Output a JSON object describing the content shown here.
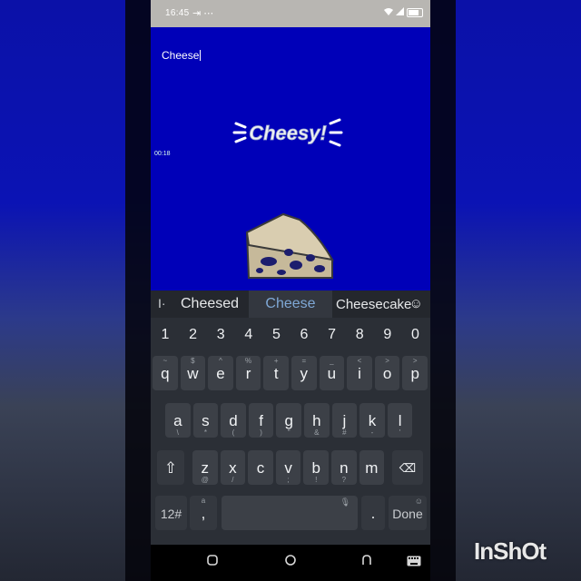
{
  "status_bar": {
    "time": "16:45",
    "misc": "⇥  ⋯",
    "icons": [
      "wifi-icon",
      "signal-icon",
      "battery-icon"
    ]
  },
  "canvas": {
    "text_field_value": "Cheese",
    "timer": "00:18",
    "sticker_text": "Cheesy!",
    "background_color": "#0000b8"
  },
  "keyboard": {
    "suggestions": [
      "Cheesed",
      "Cheese",
      "Cheesecake"
    ],
    "number_row": [
      "1",
      "2",
      "3",
      "4",
      "5",
      "6",
      "7",
      "8",
      "9",
      "0"
    ],
    "row1": [
      {
        "k": "q",
        "alt": "~"
      },
      {
        "k": "w",
        "alt": "$"
      },
      {
        "k": "e",
        "alt": "^"
      },
      {
        "k": "r",
        "alt": "%"
      },
      {
        "k": "t",
        "alt": "+"
      },
      {
        "k": "y",
        "alt": "="
      },
      {
        "k": "u",
        "alt": "_"
      },
      {
        "k": "i",
        "alt": "<"
      },
      {
        "k": "o",
        "alt": ">"
      },
      {
        "k": "p",
        "alt": ">"
      }
    ],
    "row2": [
      {
        "k": "a",
        "alt": "\\"
      },
      {
        "k": "s",
        "alt": "*"
      },
      {
        "k": "d",
        "alt": "("
      },
      {
        "k": "f",
        "alt": ")"
      },
      {
        "k": "g",
        "alt": "\""
      },
      {
        "k": "h",
        "alt": "&"
      },
      {
        "k": "j",
        "alt": "#"
      },
      {
        "k": "k",
        "alt": "-"
      },
      {
        "k": "l",
        "alt": "'"
      }
    ],
    "row3": [
      {
        "k": "z",
        "alt": "@"
      },
      {
        "k": "x",
        "alt": "/"
      },
      {
        "k": "c",
        "alt": ""
      },
      {
        "k": "v",
        "alt": ";"
      },
      {
        "k": "b",
        "alt": "!"
      },
      {
        "k": "n",
        "alt": "?"
      },
      {
        "k": "m",
        "alt": ""
      }
    ],
    "sym_label": "12#",
    "comma_label": ",",
    "comma_alt": "a",
    "period_label": ".",
    "done_label": "Done",
    "mic": "mic-icon"
  },
  "nav": [
    "recents-icon",
    "home-icon",
    "back-icon",
    "keyboard-icon"
  ],
  "watermark": "InShOt"
}
